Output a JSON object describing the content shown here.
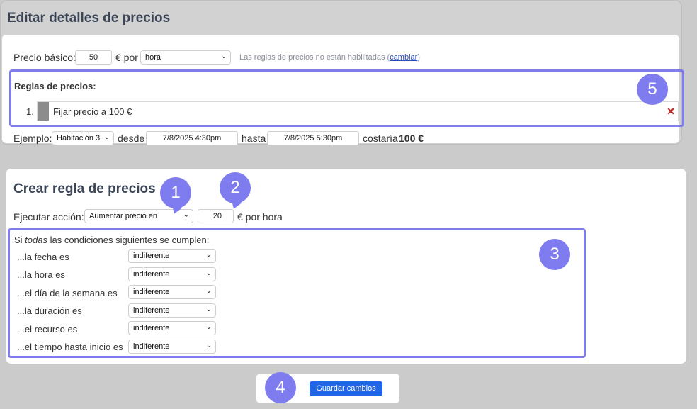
{
  "edit": {
    "title": "Editar detalles de precios",
    "base_price_label": "Precio básico:",
    "base_price_value": "50",
    "currency_per": "€ por",
    "unit_selected": "hora",
    "rules_disabled_text": "Las reglas de precios no están habilitadas (",
    "change_link": "cambiar",
    "rules_disabled_close": ")",
    "rules_title": "Reglas de precios:",
    "rules": [
      {
        "number": "1.",
        "text": "Fijar precio a 100 €"
      }
    ],
    "example_label": "Ejemplo:",
    "example_resource": "Habitación 3",
    "from_label": "desde",
    "from_value": "7/8/2025 4:30pm",
    "to_label": "hasta",
    "to_value": "7/8/2025 5:30pm",
    "cost_label": "costaría",
    "cost_value": "100 €"
  },
  "create": {
    "title": "Crear regla de precios",
    "action_label": "Ejecutar acción:",
    "action_selected": "Aumentar precio en",
    "amount_value": "20",
    "amount_unit": "€ por hora",
    "conditions_intro_before": "Si ",
    "conditions_intro_em": "todas",
    "conditions_intro_after": " las condiciones siguientes se cumplen:",
    "conditions": [
      {
        "label": "...la fecha es",
        "value": "indiferente"
      },
      {
        "label": "...la hora es",
        "value": "indiferente"
      },
      {
        "label": "...el día de la semana es",
        "value": "indiferente"
      },
      {
        "label": "...la duración es",
        "value": "indiferente"
      },
      {
        "label": "...el recurso es",
        "value": "indiferente"
      },
      {
        "label": "...el tiempo hasta inicio es",
        "value": "indiferente"
      }
    ]
  },
  "save_label": "Guardar cambios",
  "badges": [
    "1",
    "2",
    "3",
    "4",
    "5"
  ],
  "colors": {
    "accent": "#7f7cf0",
    "button": "#2266e8",
    "delete": "#d01818"
  }
}
